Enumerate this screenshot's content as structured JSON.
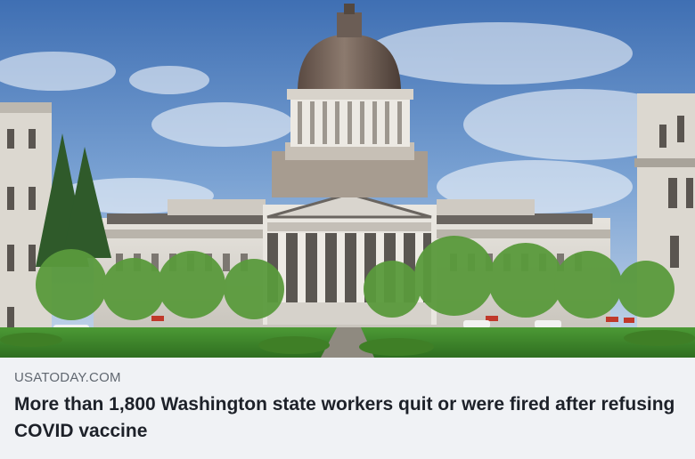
{
  "link_preview": {
    "domain": "USATODAY.COM",
    "headline": "More than 1,800 Washington state workers quit or were fired after refusing COVID vaccine",
    "image": {
      "alt": "Washington State Capitol building",
      "subject": "capitol-dome-building",
      "sky_color": "#4f7fc0",
      "lawn_color": "#3f8a2c"
    }
  }
}
